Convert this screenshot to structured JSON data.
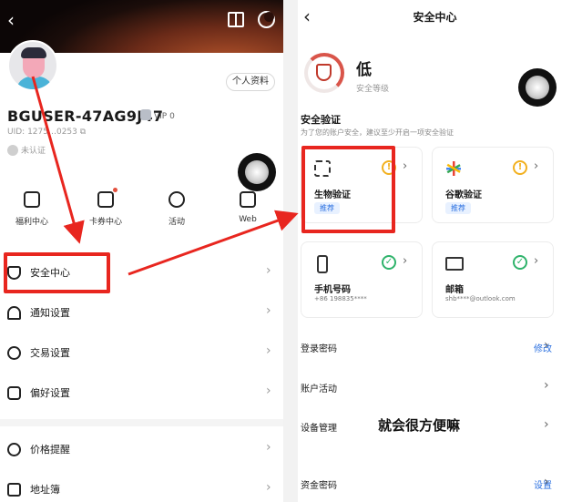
{
  "left": {
    "profile_button": "个人资料",
    "username": "BGUSER-47AG9J47",
    "vip": "VIP 0",
    "uid": "UID: 1275⁠…0253",
    "kyc_status": "未认证",
    "quick_actions": [
      {
        "label": "福利中心",
        "icon": "gift-icon"
      },
      {
        "label": "卡券中心",
        "icon": "coupon-icon"
      },
      {
        "label": "活动",
        "icon": "activity-icon"
      },
      {
        "label": "Web",
        "icon": "wallet-icon"
      }
    ],
    "menu": [
      {
        "label": "安全中心",
        "icon": "shield-icon"
      },
      {
        "label": "通知设置",
        "icon": "bell-icon"
      },
      {
        "label": "交易设置",
        "icon": "trade-icon"
      },
      {
        "label": "偏好设置",
        "icon": "settings-icon"
      },
      {
        "label": "价格提醒",
        "icon": "alarm-icon"
      },
      {
        "label": "地址簿",
        "icon": "address-book-icon"
      }
    ]
  },
  "right": {
    "title": "安全中心",
    "level_value": "低",
    "level_label": "安全等级",
    "section_title": "安全验证",
    "section_subtitle": "为了您的账户安全，建议至少开启一项安全验证",
    "cards": [
      {
        "name": "生物验证",
        "tag": "推荐",
        "status": "warning"
      },
      {
        "name": "谷歌验证",
        "tag": "推荐",
        "status": "warning"
      },
      {
        "name": "手机号码",
        "desc": "+86 198835****",
        "status": "ok"
      },
      {
        "name": "邮箱",
        "desc": "shb****@outlook.com",
        "status": "ok"
      }
    ],
    "rows": [
      {
        "label": "登录密码",
        "action": "修改"
      },
      {
        "label": "账户活动",
        "action": ""
      },
      {
        "label": "设备管理",
        "action": ""
      },
      {
        "label": "资金密码",
        "action": "设置"
      }
    ],
    "caption": "就会很方便嘛"
  },
  "colors": {
    "highlight": "#e8261f",
    "link": "#2a6fe0",
    "warning": "#f2b01e",
    "ok": "#2fb36b"
  }
}
